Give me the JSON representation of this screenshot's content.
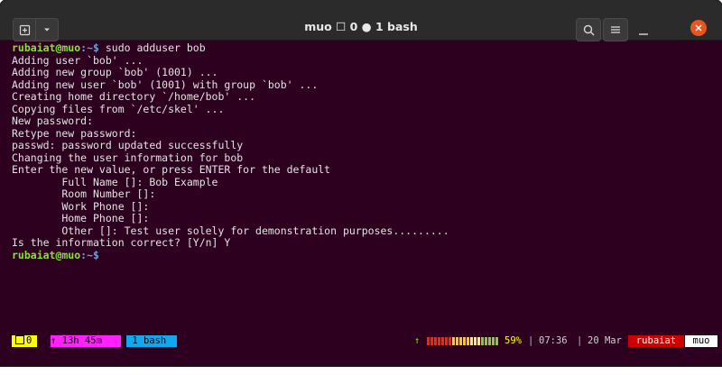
{
  "window": {
    "title": "muo ☐ 0 ● 1 bash",
    "new_tab_glyph": "⊞",
    "menu_glyph": "▾",
    "search_glyph": "🔍",
    "hamburger_glyph": "☰",
    "close_glyph": "✕"
  },
  "terminal": {
    "prompt_user": "rubaiat@muo",
    "prompt_path": ":~$",
    "lines": [
      {
        "cmd": " sudo adduser bob"
      },
      {
        "text": "Adding user `bob' ..."
      },
      {
        "text": "Adding new group `bob' (1001) ..."
      },
      {
        "text": "Adding new user `bob' (1001) with group `bob' ..."
      },
      {
        "text": "Creating home directory `/home/bob' ..."
      },
      {
        "text": "Copying files from `/etc/skel' ..."
      },
      {
        "text": "New password:"
      },
      {
        "text": "Retype new password:"
      },
      {
        "text": "passwd: password updated successfully"
      },
      {
        "text": "Changing the user information for bob"
      },
      {
        "text": "Enter the new value, or press ENTER for the default"
      },
      {
        "text": "        Full Name []: Bob Example"
      },
      {
        "text": "        Room Number []:"
      },
      {
        "text": "        Work Phone []:"
      },
      {
        "text": "        Home Phone []:"
      },
      {
        "text": "        Other []: Test user solely for demonstration purposes........."
      },
      {
        "text": "Is the information correct? [Y/n] Y"
      },
      {
        "cmd": ""
      }
    ]
  },
  "statusbar": {
    "window_index": "0",
    "uptime": "↑ 13h 45m",
    "window_name": "1 bash",
    "up_arrow": "↑",
    "battery_percent": "59%",
    "battery_value": 59,
    "separator": "|",
    "time": "07:36",
    "date": "20 Mar",
    "user": "rubaiat",
    "host": "muo"
  },
  "colors": {
    "terminal_bg": "#2c001e",
    "prompt_user": "#8ae234",
    "prompt_path": "#729fcf",
    "close_button": "#e95420"
  }
}
